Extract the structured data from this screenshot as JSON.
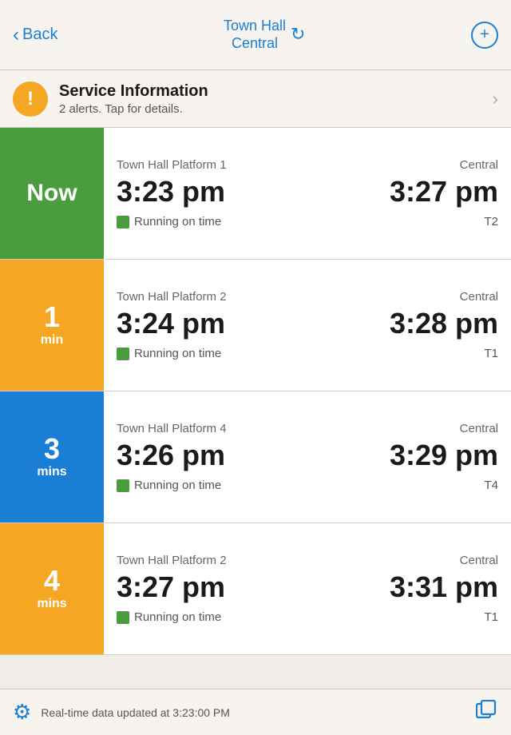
{
  "header": {
    "back_label": "Back",
    "title_line1": "Town Hall",
    "title_line2": "Central",
    "title_full": "Town Hall Central",
    "add_icon": "+"
  },
  "service_info": {
    "title": "Service Information",
    "subtitle": "2 alerts. Tap for details."
  },
  "departures": [
    {
      "badge_type": "now",
      "badge_text": "Now",
      "badge_number": "",
      "badge_unit": "",
      "platform": "Town Hall Platform 1",
      "destination": "Central",
      "depart_time": "3:23 pm",
      "arrive_time": "3:27 pm",
      "status": "Running on time",
      "track": "T2"
    },
    {
      "badge_type": "min1",
      "badge_text": "",
      "badge_number": "1",
      "badge_unit": "min",
      "platform": "Town Hall Platform 2",
      "destination": "Central",
      "depart_time": "3:24 pm",
      "arrive_time": "3:28 pm",
      "status": "Running on time",
      "track": "T1"
    },
    {
      "badge_type": "min3",
      "badge_text": "",
      "badge_number": "3",
      "badge_unit": "mins",
      "platform": "Town Hall Platform 4",
      "destination": "Central",
      "depart_time": "3:26 pm",
      "arrive_time": "3:29 pm",
      "status": "Running on time",
      "track": "T4"
    },
    {
      "badge_type": "min4",
      "badge_text": "",
      "badge_number": "4",
      "badge_unit": "mins",
      "platform": "Town Hall Platform 2",
      "destination": "Central",
      "depart_time": "3:27 pm",
      "arrive_time": "3:31 pm",
      "status": "Running on time",
      "track": "T1"
    }
  ],
  "footer": {
    "status_text": "Real-time data updated at 3:23:00 PM"
  }
}
